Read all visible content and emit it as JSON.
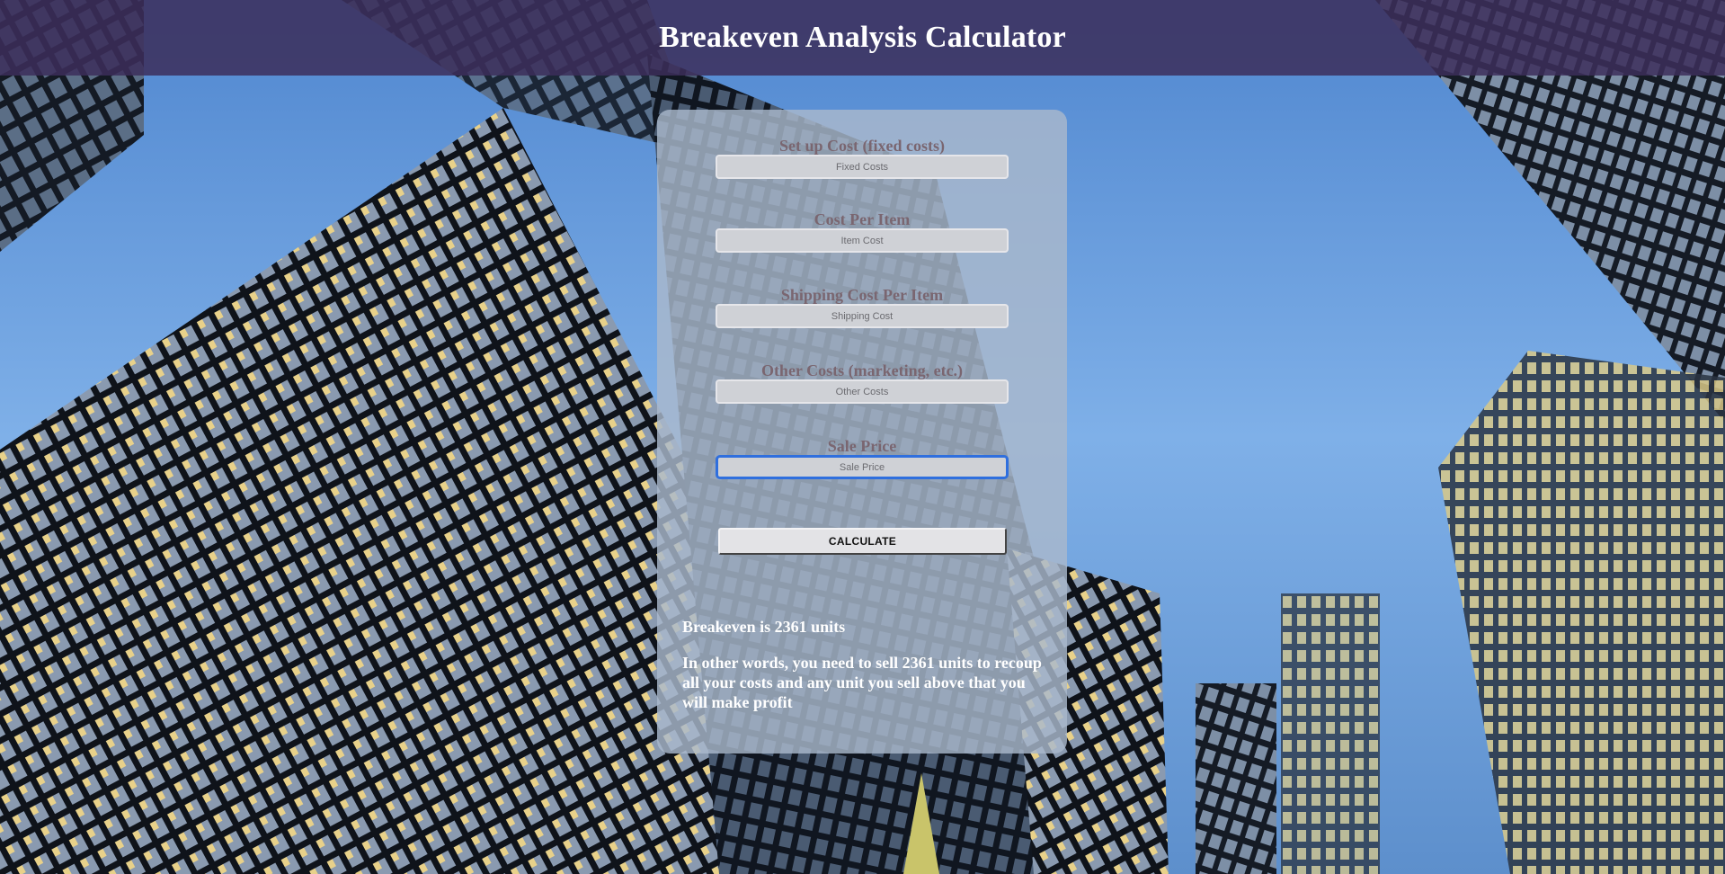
{
  "header": {
    "title": "Breakeven Analysis Calculator"
  },
  "form": {
    "fields": [
      {
        "label": "Set up Cost (fixed costs)",
        "placeholder": "Fixed Costs",
        "value": ""
      },
      {
        "label": "Cost Per Item",
        "placeholder": "Item Cost",
        "value": ""
      },
      {
        "label": "Shipping Cost Per Item",
        "placeholder": "Shipping Cost",
        "value": ""
      },
      {
        "label": "Other Costs (marketing, etc.)",
        "placeholder": "Other Costs",
        "value": ""
      },
      {
        "label": "Sale Price",
        "placeholder": "Sale Price",
        "value": ""
      }
    ],
    "calculate_label": "CALCULATE"
  },
  "result": {
    "headline": "Breakeven is 2361 units",
    "explanation": "In other words, you need to sell 2361 units to recoup all your costs and any unit you sell above that you will make profit"
  },
  "colors": {
    "header_bg": "#3c2e5a",
    "card_bg": "#aab8cc",
    "label_text": "#7a6670",
    "focus_ring": "#2f6fde"
  }
}
